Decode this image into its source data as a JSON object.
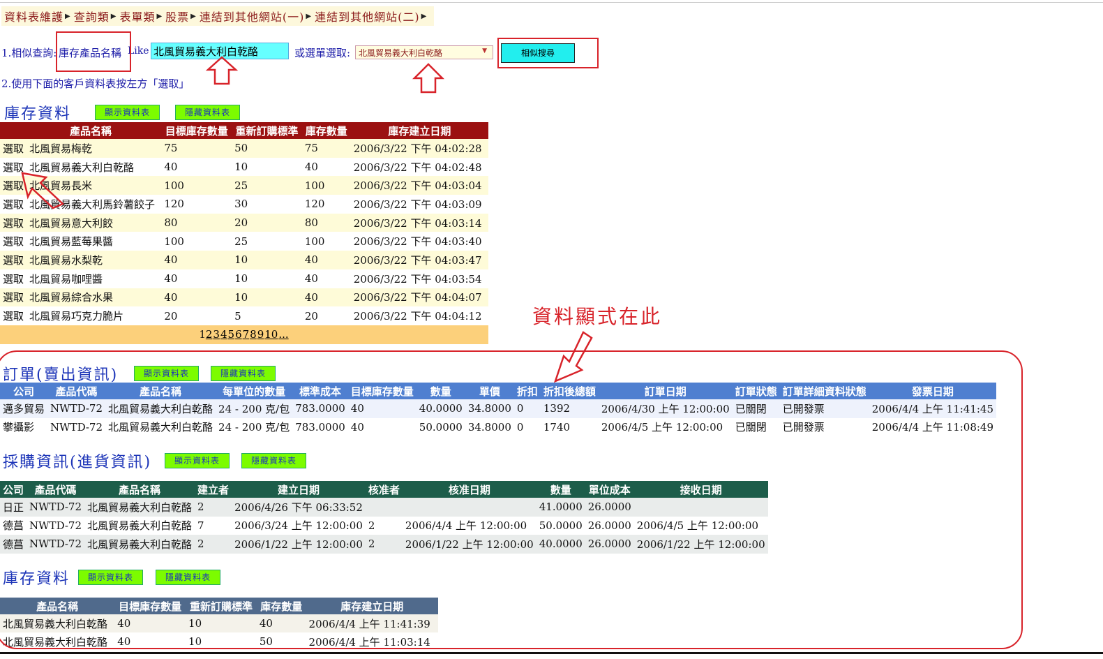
{
  "menu": [
    {
      "label": "資料表維護"
    },
    {
      "label": "查詢類"
    },
    {
      "label": "表單類"
    },
    {
      "label": "股票"
    },
    {
      "label": "連結到其他網站(一)"
    },
    {
      "label": "連結到其他網站(二)"
    }
  ],
  "search": {
    "prefix": "1.相似查詢:",
    "field_label": "庫存產品名稱",
    "like": "Like",
    "input_value": "北風貿易義大利白乾酪",
    "or_select_label": "或選單選取:",
    "select_value": "北風貿易義大利白乾酪",
    "button_label": "相似搜尋"
  },
  "instruction": "2.使用下面的客戶資料表按左方「選取」",
  "annotation": "資料顯式在此",
  "buttons": {
    "show": "顯示資料表",
    "hide": "隱藏資料表"
  },
  "colors": {
    "accent_red": "#d8232a",
    "inventory_header": "#9b1111",
    "orders_header": "#4f7fd0",
    "purchase_header": "#1d5d4a",
    "stock_header": "#506a8c"
  },
  "inventory": {
    "title": "庫存資料",
    "columns": [
      "產品名稱",
      "目標庫存數量",
      "重新訂購標準",
      "庫存數量",
      "庫存建立日期"
    ],
    "select_label": "選取",
    "rows": [
      [
        "北風貿易梅乾",
        "75",
        "50",
        "75",
        "2006/3/22 下午 04:02:28"
      ],
      [
        "北風貿易義大利白乾酪",
        "40",
        "10",
        "40",
        "2006/3/22 下午 04:02:48"
      ],
      [
        "北風貿易長米",
        "100",
        "25",
        "100",
        "2006/3/22 下午 04:03:04"
      ],
      [
        "北風貿易義大利馬鈴薯餃子",
        "120",
        "30",
        "120",
        "2006/3/22 下午 04:03:09"
      ],
      [
        "北風貿易意大利餃",
        "80",
        "20",
        "80",
        "2006/3/22 下午 04:03:14"
      ],
      [
        "北風貿易藍莓果醬",
        "100",
        "25",
        "100",
        "2006/3/22 下午 04:03:40"
      ],
      [
        "北風貿易水梨乾",
        "40",
        "10",
        "40",
        "2006/3/22 下午 04:03:47"
      ],
      [
        "北風貿易咖哩醬",
        "40",
        "10",
        "40",
        "2006/3/22 下午 04:03:54"
      ],
      [
        "北風貿易綜合水果",
        "40",
        "10",
        "40",
        "2006/3/22 下午 04:04:07"
      ],
      [
        "北風貿易巧克力脆片",
        "20",
        "5",
        "20",
        "2006/3/22 下午 04:04:12"
      ]
    ],
    "pages": [
      "1",
      "2",
      "3",
      "4",
      "5",
      "6",
      "7",
      "8",
      "9",
      "10",
      "..."
    ]
  },
  "orders": {
    "title": "訂單(賣出資訊)",
    "columns": [
      "公司",
      "產品代碼",
      "產品名稱",
      "每單位的數量",
      "標準成本",
      "目標庫存數量",
      "數量",
      "單價",
      "折扣",
      "折扣後總額",
      "訂單日期",
      "訂單狀態",
      "訂單詳細資料狀態",
      "發票日期"
    ],
    "rows": [
      [
        "邁多貿易",
        "NWTD-72",
        "北風貿易義大利白乾酪",
        "24 - 200 克/包",
        "783.0000",
        "40",
        "40.0000",
        "34.8000",
        "0",
        "1392",
        "2006/4/30 上午 12:00:00",
        "已關閉",
        "已開發票",
        "2006/4/4 上午 11:41:45"
      ],
      [
        "攀攝影",
        "NWTD-72",
        "北風貿易義大利白乾酪",
        "24 - 200 克/包",
        "783.0000",
        "40",
        "50.0000",
        "34.8000",
        "0",
        "1740",
        "2006/4/5 上午 12:00:00",
        "已關閉",
        "已開發票",
        "2006/4/4 上午 11:08:49"
      ]
    ]
  },
  "purchases": {
    "title": "採購資訊(進貨資訊)",
    "columns": [
      "公司",
      "產品代碼",
      "產品名稱",
      "建立者",
      "建立日期",
      "核准者",
      "核准日期",
      "數量",
      "單位成本",
      "接收日期"
    ],
    "rows": [
      [
        "日正",
        "NWTD-72",
        "北風貿易義大利白乾酪",
        "2",
        "2006/4/26 下午 06:33:52",
        "",
        "",
        "41.0000",
        "26.0000",
        ""
      ],
      [
        "德菖",
        "NWTD-72",
        "北風貿易義大利白乾酪",
        "7",
        "2006/3/24 上午 12:00:00",
        "2",
        "2006/4/4 上午 12:00:00",
        "50.0000",
        "26.0000",
        "2006/4/5 上午 12:00:00"
      ],
      [
        "德菖",
        "NWTD-72",
        "北風貿易義大利白乾酪",
        "2",
        "2006/1/22 上午 12:00:00",
        "2",
        "2006/1/22 上午 12:00:00",
        "40.0000",
        "26.0000",
        "2006/1/22 上午 12:00:00"
      ]
    ]
  },
  "stock": {
    "title": "庫存資料",
    "columns": [
      "產品名稱",
      "目標庫存數量",
      "重新訂購標準",
      "庫存數量",
      "庫存建立日期"
    ],
    "rows": [
      [
        "北風貿易義大利白乾酪",
        "40",
        "10",
        "40",
        "2006/4/4 上午 11:41:39"
      ],
      [
        "北風貿易義大利白乾酪",
        "40",
        "10",
        "50",
        "2006/4/4 上午 11:03:14"
      ]
    ]
  }
}
